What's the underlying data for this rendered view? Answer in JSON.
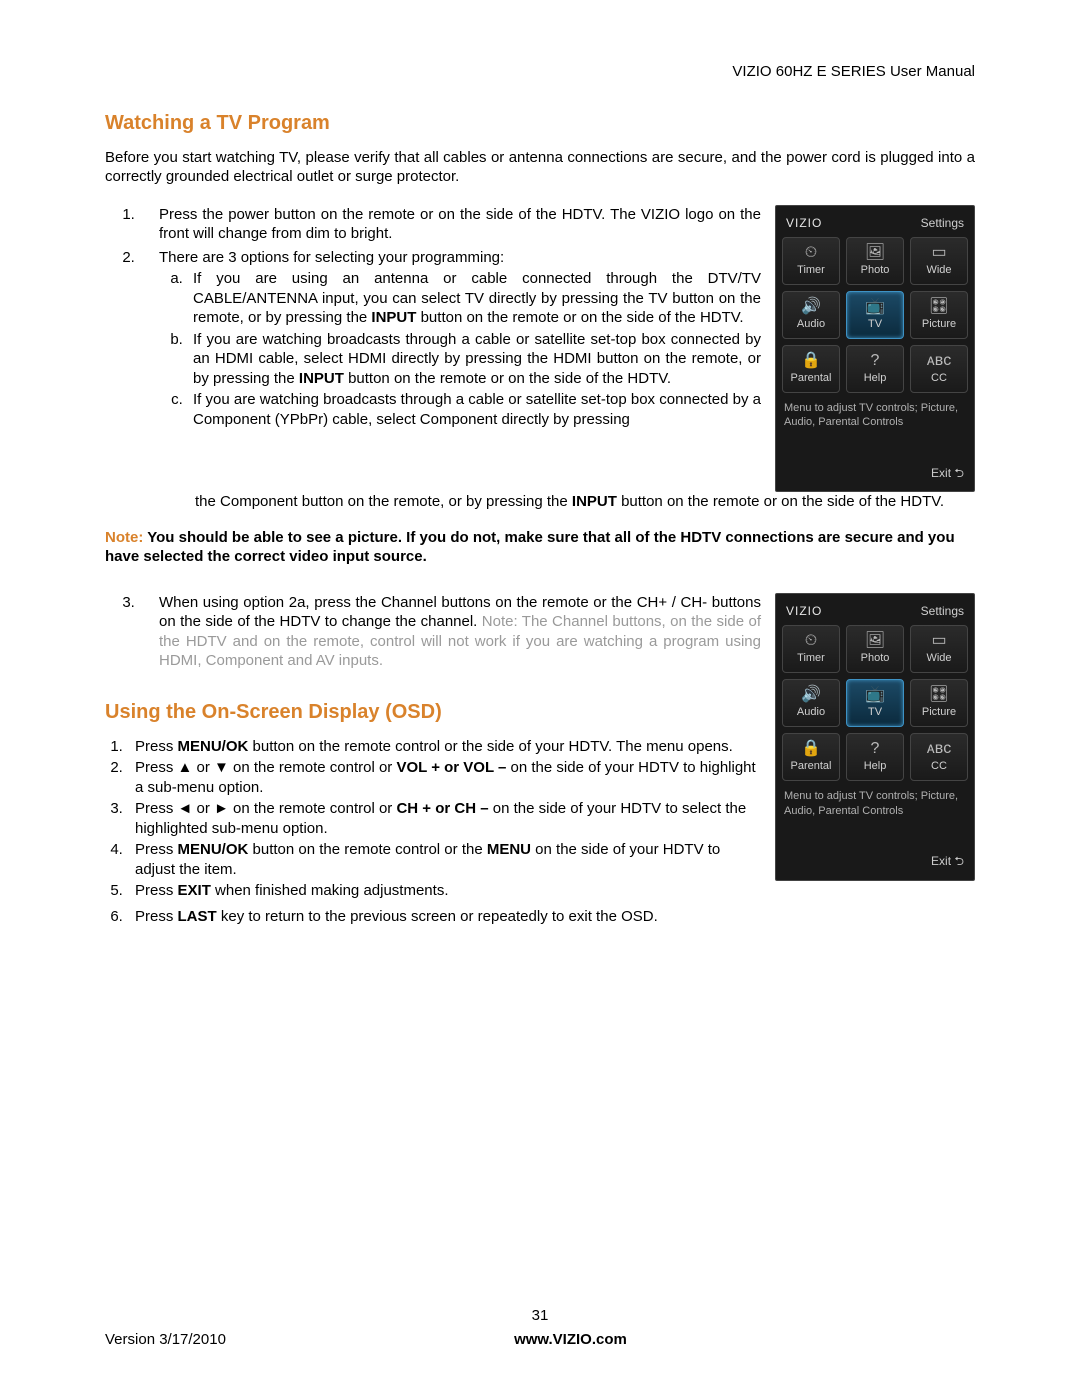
{
  "doc_header": "VIZIO 60HZ E SERIES User Manual",
  "section1": {
    "title": "Watching a TV Program",
    "intro": "Before you start watching TV, please verify that all cables or antenna connections are secure, and the power cord is plugged into a correctly grounded electrical outlet or surge protector.",
    "step1": "Press the power button on the remote or on the side of the HDTV.  The VIZIO logo on the front will change from dim to bright.",
    "step2_intro": "There are 3 options for selecting your programming:",
    "opt_a_pre": "If you are using an antenna or cable connected through the DTV/TV CABLE/ANTENNA input, you can select TV directly by pressing the TV button on the remote, or by pressing the ",
    "opt_a_bold": "INPUT",
    "opt_a_post": " button on the remote or on the side of the HDTV.",
    "opt_b_pre": "If you are watching broadcasts through a cable or satellite set-top box connected by an HDMI cable, select HDMI directly by pressing the HDMI button on the remote, or by pressing the ",
    "opt_b_bold": "INPUT",
    "opt_b_post": " button on the remote or on the side of the HDTV.",
    "opt_c_pre": "If you are watching broadcasts through a cable or satellite set-top box connected by a Component (YPbPr) cable, select Component directly by pressing",
    "opt_c_cont_pre": "the Component button on the remote, or by pressing the ",
    "opt_c_cont_bold": "INPUT",
    "opt_c_cont_post": " button on the remote or on the side of the HDTV.",
    "note_label": "Note:",
    "note_body": " You should be able to see a picture.  If you do not, make sure that all of the HDTV connections are secure and you have selected the correct video input source.",
    "step3_pre": "When using option 2a, press the Channel buttons on the remote or the CH+ / CH- buttons on the side of the HDTV to change the channel.  ",
    "step3_note": "Note: The Channel buttons, on the side of the HDTV and on the remote, control will not work if you are watching a program using HDMI, Component and AV inputs."
  },
  "section2": {
    "title": "Using the On-Screen Display (OSD)",
    "s1_a": "Press ",
    "s1_b": "MENU/OK",
    "s1_c": " button on the remote control or the side of your HDTV. The menu opens.",
    "s2_a": "Press ▲ or ▼ on the remote control or ",
    "s2_b": "VOL + or VOL –",
    "s2_c": " on the side of your HDTV to highlight a sub-menu option.",
    "s3_a": "Press ◄ or ► on the remote control or ",
    "s3_b": "CH + or CH –",
    "s3_c": " on the side of your HDTV to select the highlighted sub-menu option.",
    "s4_a": "Press ",
    "s4_b": "MENU/OK",
    "s4_c": " button on the remote control or the ",
    "s4_d": "MENU",
    "s4_e": " on the side of your HDTV to adjust the item.",
    "s5_a": "Press ",
    "s5_b": "EXIT",
    "s5_c": " when finished making adjustments.",
    "s6_a": "Press ",
    "s6_b": "LAST",
    "s6_c": " key to return to the previous screen or repeatedly to exit the OSD."
  },
  "osd_panel": {
    "brand": "VIZIO",
    "settings": "Settings",
    "tiles": [
      "Timer",
      "Photo",
      "Wide",
      "Audio",
      "TV",
      "Picture",
      "Parental",
      "Help",
      "CC"
    ],
    "selected": 4,
    "hint": "Menu to adjust TV controls; Picture, Audio, Parental Controls",
    "exit": "Exit ⮌"
  },
  "icons": [
    "⏲",
    "🖼",
    "▭",
    "🔊",
    "📺",
    "🎛",
    "🔒",
    "?",
    "ᴀʙᴄ"
  ],
  "footer": {
    "page_number": "31",
    "version": "Version 3/17/2010",
    "url": "www.VIZIO.com"
  }
}
